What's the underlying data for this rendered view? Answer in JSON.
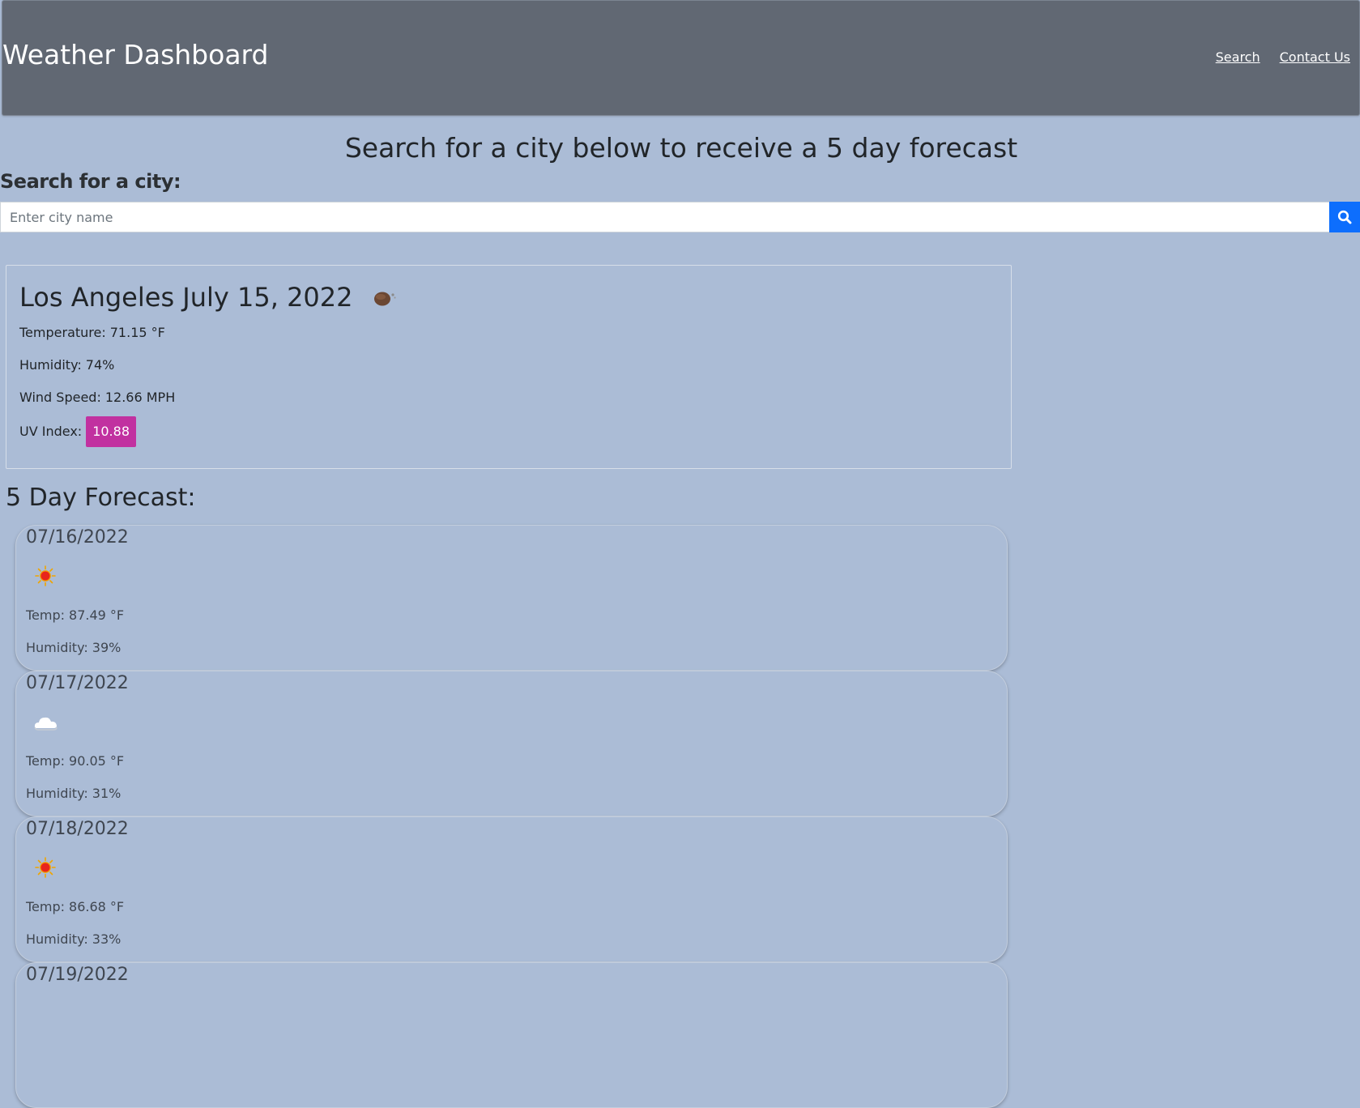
{
  "header": {
    "title": "Weather Dashboard",
    "nav": [
      {
        "label": "Search",
        "icon": ""
      },
      {
        "label": "Contact Us",
        "icon": ""
      }
    ]
  },
  "main": {
    "heading": "Search for a city below to receive a 5 day forecast",
    "search": {
      "label": "Search for a city:",
      "placeholder": "Enter city name",
      "value": "",
      "button_icon": "search-icon"
    },
    "current": {
      "city": "Los Angeles",
      "date": "July 15, 2022",
      "icon": "moon-cloud-icon",
      "temperature_label": "Temperature:",
      "temperature_value": "71.15 °F",
      "humidity_label": "Humidity:",
      "humidity_value": "74%",
      "wind_label": "Wind Speed:",
      "wind_value": "12.66 MPH",
      "uv_label": "UV Index:",
      "uv_value": "10.88"
    },
    "forecast": {
      "heading": "5 Day Forecast:",
      "days": [
        {
          "date": "07/16/2022",
          "icon": "sun-icon",
          "temp_label": "Temp:",
          "temp": "87.49 °F",
          "humidity_label": "Humidity:",
          "humidity": "39%"
        },
        {
          "date": "07/17/2022",
          "icon": "cloud-icon",
          "temp_label": "Temp:",
          "temp": "90.05 °F",
          "humidity_label": "Humidity:",
          "humidity": "31%"
        },
        {
          "date": "07/18/2022",
          "icon": "sun-icon",
          "temp_label": "Temp:",
          "temp": "86.68 °F",
          "humidity_label": "Humidity:",
          "humidity": "33%"
        },
        {
          "date": "07/19/2022",
          "icon": "",
          "temp_label": "",
          "temp": "",
          "humidity_label": "",
          "humidity": ""
        }
      ]
    }
  },
  "colors": {
    "page_bg": "#abbcd6",
    "header_bg": "#616873",
    "search_button": "#0d6efd",
    "uv_badge": "#c131a0"
  }
}
